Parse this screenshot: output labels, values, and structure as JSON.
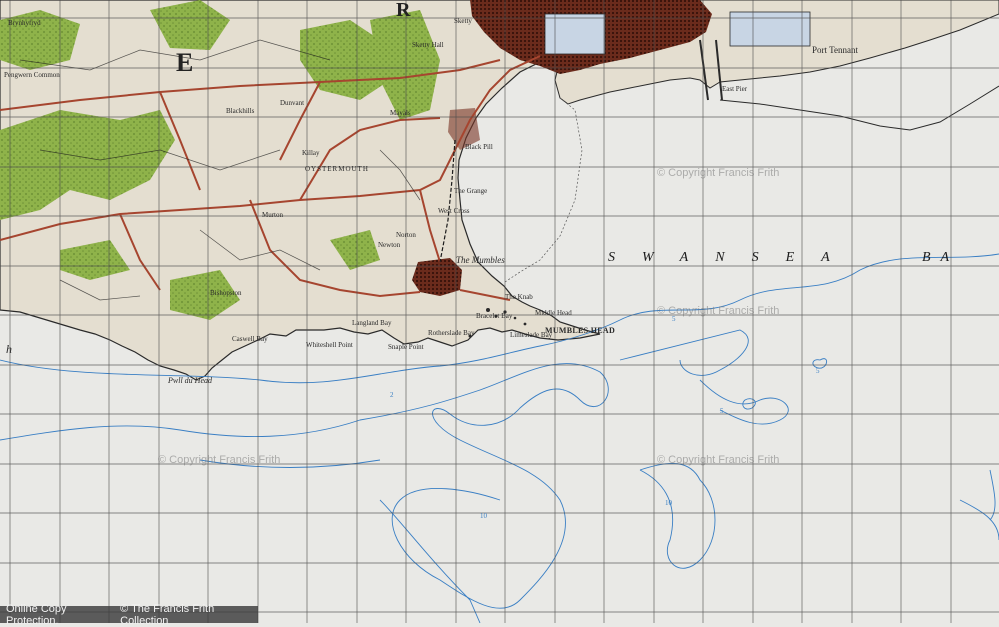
{
  "map": {
    "colors": {
      "sea": "#e9e9e6",
      "land": "#e4ded0",
      "woodland": "#8fb34a",
      "urban": "#5a2418",
      "roads": "#a6452f",
      "contours": "#3a7fc4",
      "grid": "#4a4a4a",
      "coastline": "#2a2a2a"
    },
    "labels": {
      "bay": "SWANSEA",
      "bay_end": "BA",
      "mumbles_head": "MUMBLES HEAD",
      "the_mumbles": "The Mumbles",
      "oystermouth": "OYSTERMOUTH",
      "port_tennant": "Port Tennant",
      "pwll_du_head": "Pwll du Head",
      "whiteshell_point": "Whiteshell Point",
      "pengwern_common": "Pengwern Common",
      "black_pill": "Black Pill",
      "the_grange": "The Grange",
      "the_knab": "The Knab",
      "middle_head": "Middle Head",
      "limeslade_bay": "Limeslade Bay",
      "bracelet_bay": "Bracelet Bay",
      "caswell_bay": "Caswell Bay",
      "langland_bay": "Langland Bay",
      "rotherslade_bay": "Rotherslade Bay",
      "snaple_point": "Snaple Point",
      "newton": "Newton",
      "west_cross": "West Cross",
      "sketty": "Sketty",
      "east_pier": "East Pier",
      "mayals": "Mayals",
      "norton": "Norton",
      "bishopston": "Bishopston",
      "murton": "Murton",
      "killay": "Killay",
      "dunvant": "Dunvant",
      "blackhills": "Blackhills",
      "brynhyfryd": "Brynhyfryd",
      "sketty_hall": "Sketty Hall",
      "big_e": "E",
      "big_r": "R",
      "h_edge": "h"
    },
    "contour_values": [
      "2",
      "5",
      "10",
      "5",
      "10",
      "5"
    ]
  },
  "watermarks": [
    "© Copyright Francis Frith",
    "© Copyright Francis Frith",
    "© Copyright Francis Frith",
    "© Copyright Francis Frith"
  ],
  "footer": {
    "online_copy": "Online Copy Protection.",
    "copyright": "© The Francis Frith Collection"
  }
}
